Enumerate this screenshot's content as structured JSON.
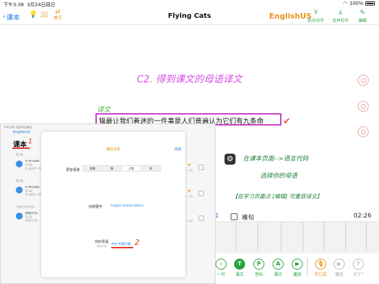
{
  "status": {
    "time": "下午3:38",
    "date": "3月24日周日",
    "battery": "100%"
  },
  "nav": {
    "back_label": "课本",
    "mode_label": "模式",
    "title": "Flying Cats",
    "lang": "EnglishUS",
    "tools": [
      {
        "label": "拆分句子"
      },
      {
        "label": "合并句子"
      },
      {
        "label": "编辑"
      }
    ]
  },
  "main": {
    "heading": "C2. 得到课文的母语译文",
    "translation_label": "译文",
    "sentence": "猫最让我们着迷的一件事是人们普遍认为它们有九条命"
  },
  "annotations": {
    "step1": "在课本页面-->语言代码",
    "step2": "选择你的母语",
    "step3": "【在学习页面点 [编辑] 可重获译文】"
  },
  "row": {
    "num": "1",
    "label": "难句",
    "time": "02:26"
  },
  "toolbar": {
    "buttons": [
      {
        "letter": "",
        "label": "一句"
      },
      {
        "letter": "T",
        "label": "课文"
      },
      {
        "letter": "P",
        "label": "音标"
      },
      {
        "letter": "A",
        "label": "课文"
      },
      {
        "letter": "",
        "label": "播放"
      },
      {
        "letter": "",
        "label": "开口说"
      },
      {
        "letter": "",
        "label": "播放"
      },
      {
        "letter": "?",
        "label": "对了?"
      }
    ]
  },
  "overlay": {
    "status": "下午2:01  3月24日周日",
    "app_label": "EnglishUS",
    "title": "课本",
    "num_marker": "1",
    "section1": "第1课",
    "section2": "第2课",
    "section3": "只能打开的文件",
    "items": [
      {
        "title": "A Private",
        "sub1": "0:08",
        "sub2": "English US"
      },
      {
        "title": "A Private",
        "sub1": "0:18",
        "sub2": "English US"
      },
      {
        "title": "你好什么",
        "sub1": "0:11",
        "sub2": "中文 CN"
      }
    ],
    "right_rows": [
      {
        "star": "★",
        "range": "0 - 21"
      },
      {
        "star": "★",
        "range": "0 - 21"
      },
      {
        "star": "",
        "range": "0 - 21"
      }
    ],
    "modal": {
      "title": "偏好设置",
      "done": "完成",
      "speed_label": "录音语速",
      "speed_options": [
        "较慢",
        "慢",
        "正常",
        "快"
      ],
      "speed_selected": "正常",
      "learn_label": "你想要学",
      "learn_value": "English United States",
      "native_label": "你的母语",
      "native_sub": "语言代码",
      "native_value": "中文 中国大陆",
      "num_marker": "2"
    }
  }
}
